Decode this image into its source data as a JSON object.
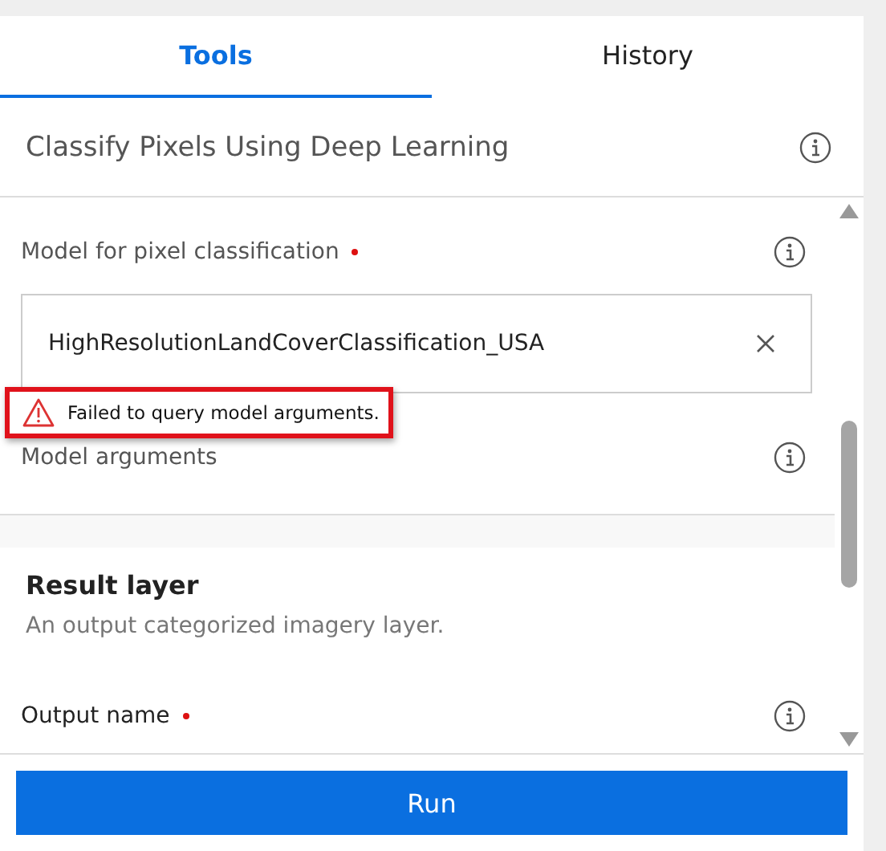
{
  "tabs": [
    {
      "label": "Tools",
      "selected": true
    },
    {
      "label": "History",
      "selected": false
    }
  ],
  "tool_title": "Classify Pixels Using Deep Learning",
  "model_field": {
    "label": "Model for pixel classification",
    "required": true,
    "value": "HighResolutionLandCoverClassification_USA",
    "error": "Failed to query model arguments."
  },
  "model_arguments": {
    "label": "Model arguments"
  },
  "result_section": {
    "title": "Result layer",
    "description": "An output categorized imagery layer.",
    "output_label": "Output name",
    "output_required": true
  },
  "run_button": "Run"
}
